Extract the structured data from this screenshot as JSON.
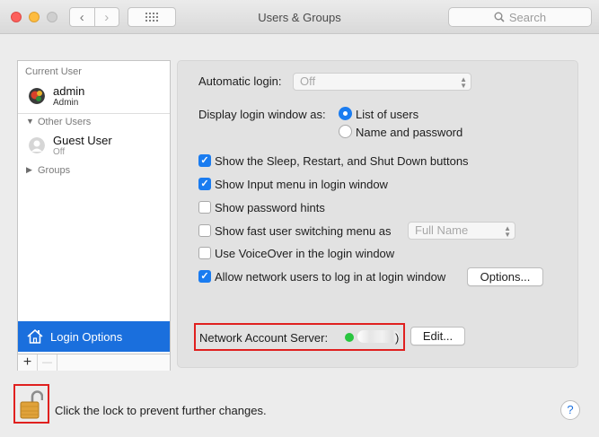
{
  "window": {
    "title": "Users & Groups"
  },
  "toolbar": {
    "back_glyph": "‹",
    "forward_glyph": "›",
    "search_placeholder": "Search"
  },
  "sidebar": {
    "current_user_header": "Current User",
    "current_user": {
      "name": "admin",
      "role": "Admin"
    },
    "other_users_header": "Other Users",
    "other_users": [
      {
        "name": "Guest User",
        "status": "Off"
      }
    ],
    "groups_header": "Groups",
    "selected_item": "Login Options",
    "add_glyph": "+",
    "remove_glyph": "—"
  },
  "login_options": {
    "automatic_login_label": "Automatic login:",
    "automatic_login_value": "Off",
    "display_login_label": "Display login window as:",
    "display_options": [
      "List of users",
      "Name and password"
    ],
    "display_selected": "List of users",
    "checkboxes": [
      {
        "label": "Show the Sleep, Restart, and Shut Down buttons",
        "checked": true
      },
      {
        "label": "Show Input menu in login window",
        "checked": true
      },
      {
        "label": "Show password hints",
        "checked": false
      },
      {
        "label": "Show fast user switching menu as",
        "checked": false
      },
      {
        "label": "Use VoiceOver in the login window",
        "checked": false
      },
      {
        "label": "Allow network users to log in at login window",
        "checked": true
      }
    ],
    "fast_switch_value": "Full Name",
    "options_button": "Options...",
    "network_server_label": "Network Account Server:",
    "network_server_status": "connected",
    "network_server_trailing": ")",
    "edit_button": "Edit..."
  },
  "footer": {
    "lock_text": "Click the lock to prevent further changes.",
    "help_glyph": "?"
  },
  "colors": {
    "accent": "#1a6fdd",
    "checkbox": "#1a7cf0",
    "status_green": "#29c53f",
    "highlight_red": "#e0201f"
  }
}
